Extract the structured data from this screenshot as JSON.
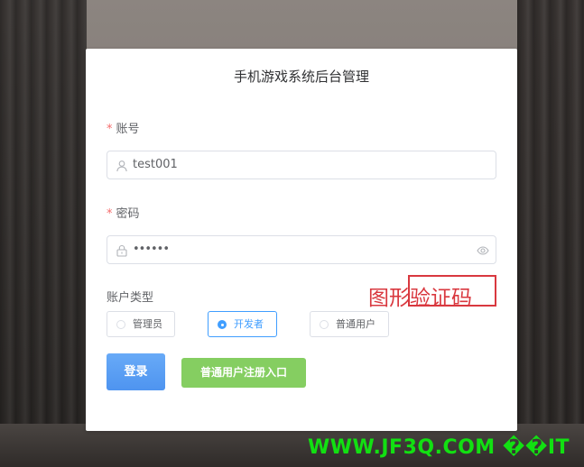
{
  "app": {
    "title": "手机游戏系统后台管理"
  },
  "form": {
    "account_label": "账号",
    "account_value": "test001",
    "password_label": "密码",
    "password_value": "••••••",
    "required_mark": "*",
    "account_type_label": "账户类型",
    "account_types": [
      {
        "label": "管理员",
        "selected": false
      },
      {
        "label": "开发者",
        "selected": true
      },
      {
        "label": "普通用户",
        "selected": false
      }
    ],
    "login_label": "登录",
    "register_label": "普通用户注册入口"
  },
  "annotation": {
    "captcha_text": "图形验证码"
  },
  "watermark": {
    "text": "WWW.JF3Q.COM ��IT"
  },
  "colors": {
    "accent": "#409eff",
    "success": "#85ce61",
    "danger": "#f56c6c",
    "annotation": "#d9383f",
    "watermark": "#12e012"
  },
  "icons": {
    "account_prefix": "user-icon",
    "password_prefix": "lock-icon",
    "password_suffix": "eye-icon"
  }
}
